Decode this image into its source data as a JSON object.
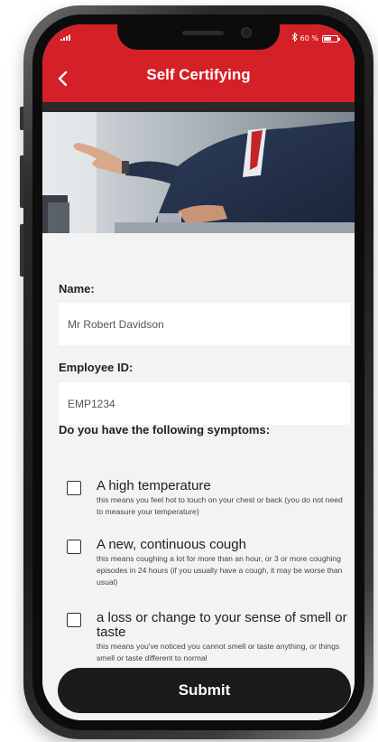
{
  "status_bar": {
    "signal": "•••••ıll",
    "battery_text": "60 %",
    "battery_level": 0.6
  },
  "header": {
    "title": "Self Certifying",
    "back_icon": "chevron-left-icon",
    "background_color": "#d42027"
  },
  "form": {
    "name_label": "Name:",
    "name_value": "Mr Robert Davidson",
    "employee_id_label": "Employee ID:",
    "employee_id_value": "EMP1234",
    "symptoms_question": "Do you have the following symptoms:",
    "symptoms": [
      {
        "title": "A high temperature",
        "description": "this means you feel hot to touch on your chest or back (you do not need to measure your temperature)",
        "checked": false
      },
      {
        "title": "A new, continuous cough",
        "description": "this means coughing a lot for more than an hour, or 3 or more coughing episodes in 24 hours (if you usually have a cough, it may be worse than usual)",
        "checked": false
      },
      {
        "title": "a loss or change to your sense of smell or taste",
        "description": "this means you've noticed you cannot smell or taste anything, or things smell or taste different to normal",
        "checked": false
      }
    ],
    "submit_label": "Submit"
  }
}
